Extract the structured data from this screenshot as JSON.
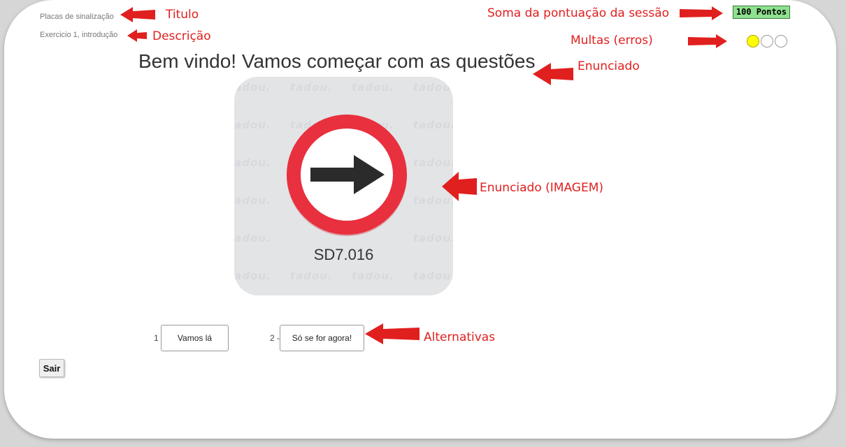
{
  "header": {
    "title": "Placas de sinalização",
    "description": "Exercicio 1, introdução",
    "score": "100 Pontos"
  },
  "fines": {
    "total": 3,
    "used": 1,
    "active_color": "#ffff00"
  },
  "question": {
    "text": "Bem vindo! Vamos começar com as questões",
    "image": {
      "watermark": "tadou.",
      "sign_code": "SD7.016",
      "sign_icon": "arrow-right-icon",
      "sign_ring_color": "#e8303e"
    }
  },
  "alternatives": [
    {
      "number": "1 -",
      "label": "Vamos lá"
    },
    {
      "number": "2 -",
      "label": "Só se for agora!"
    }
  ],
  "exit_label": "Sair",
  "annotations": {
    "titulo": "Titulo",
    "descricao": "Descrição",
    "soma": "Soma da pontuação da sessão",
    "multas": "Multas (erros)",
    "enunciado": "Enunciado",
    "enunciado_imagem": "Enunciado (IMAGEM)",
    "alternativas": "Alternativas",
    "color": "#e0201f"
  }
}
